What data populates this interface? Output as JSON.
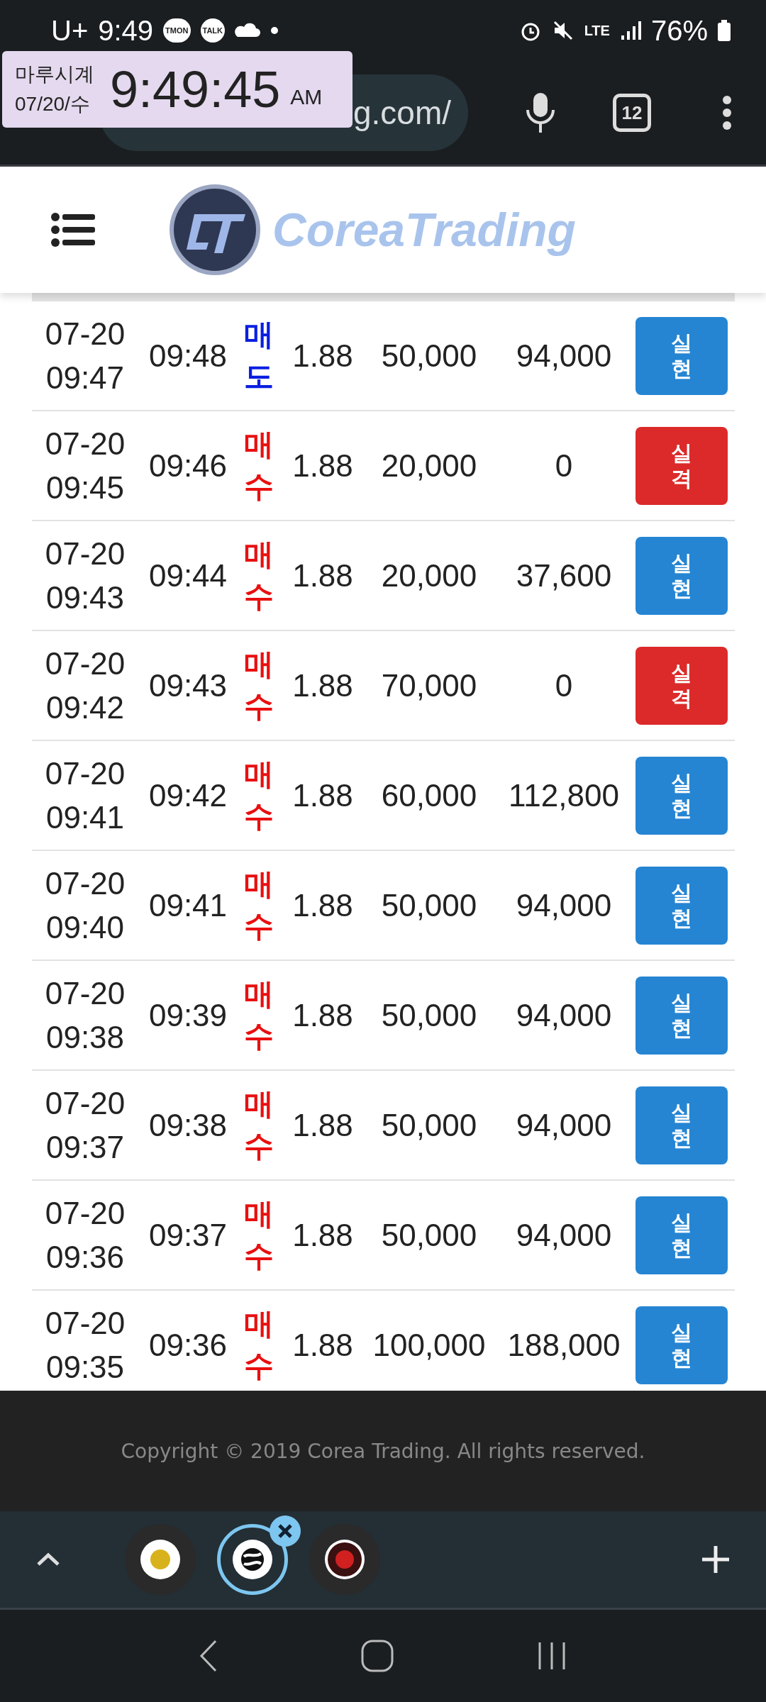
{
  "status_bar": {
    "carrier": "U+",
    "time": "9:49",
    "notifications": [
      "TMON",
      "TALK"
    ],
    "battery": "76%",
    "network": "LTE"
  },
  "browser": {
    "url": "g.com/",
    "tab_count": "12"
  },
  "clock_widget": {
    "name": "마루시계",
    "date": "07/20/수",
    "time": "9:49:45",
    "ampm": "AM"
  },
  "site_header": {
    "logo_text": "CoreaTrading"
  },
  "rows": [
    {
      "date": "07-20",
      "start": "09:47",
      "end": "09:48",
      "side": {
        "text": "매도",
        "kind": "sell"
      },
      "rate": "1.88",
      "amount": "50,000",
      "payout": "94,000",
      "result": {
        "text": "실현",
        "kind": "win"
      }
    },
    {
      "date": "07-20",
      "start": "09:45",
      "end": "09:46",
      "side": {
        "text": "매수",
        "kind": "buy"
      },
      "rate": "1.88",
      "amount": "20,000",
      "payout": "0",
      "result": {
        "text": "실격",
        "kind": "lose"
      }
    },
    {
      "date": "07-20",
      "start": "09:43",
      "end": "09:44",
      "side": {
        "text": "매수",
        "kind": "buy"
      },
      "rate": "1.88",
      "amount": "20,000",
      "payout": "37,600",
      "result": {
        "text": "실현",
        "kind": "win"
      }
    },
    {
      "date": "07-20",
      "start": "09:42",
      "end": "09:43",
      "side": {
        "text": "매수",
        "kind": "buy"
      },
      "rate": "1.88",
      "amount": "70,000",
      "payout": "0",
      "result": {
        "text": "실격",
        "kind": "lose"
      }
    },
    {
      "date": "07-20",
      "start": "09:41",
      "end": "09:42",
      "side": {
        "text": "매수",
        "kind": "buy"
      },
      "rate": "1.88",
      "amount": "60,000",
      "payout": "112,800",
      "result": {
        "text": "실현",
        "kind": "win"
      }
    },
    {
      "date": "07-20",
      "start": "09:40",
      "end": "09:41",
      "side": {
        "text": "매수",
        "kind": "buy"
      },
      "rate": "1.88",
      "amount": "50,000",
      "payout": "94,000",
      "result": {
        "text": "실현",
        "kind": "win"
      }
    },
    {
      "date": "07-20",
      "start": "09:38",
      "end": "09:39",
      "side": {
        "text": "매수",
        "kind": "buy"
      },
      "rate": "1.88",
      "amount": "50,000",
      "payout": "94,000",
      "result": {
        "text": "실현",
        "kind": "win"
      }
    },
    {
      "date": "07-20",
      "start": "09:37",
      "end": "09:38",
      "side": {
        "text": "매수",
        "kind": "buy"
      },
      "rate": "1.88",
      "amount": "50,000",
      "payout": "94,000",
      "result": {
        "text": "실현",
        "kind": "win"
      }
    },
    {
      "date": "07-20",
      "start": "09:36",
      "end": "09:37",
      "side": {
        "text": "매수",
        "kind": "buy"
      },
      "rate": "1.88",
      "amount": "50,000",
      "payout": "94,000",
      "result": {
        "text": "실현",
        "kind": "win"
      }
    },
    {
      "date": "07-20",
      "start": "09:35",
      "end": "09:36",
      "side": {
        "text": "매수",
        "kind": "buy"
      },
      "rate": "1.88",
      "amount": "100,000",
      "payout": "188,000",
      "result": {
        "text": "실현",
        "kind": "win"
      }
    }
  ],
  "footer": {
    "copyright": "Copyright © 2019 Corea Trading. All rights reserved."
  },
  "tab_strip": {
    "tabs": [
      {
        "selected": false
      },
      {
        "selected": true
      },
      {
        "selected": false
      }
    ]
  }
}
